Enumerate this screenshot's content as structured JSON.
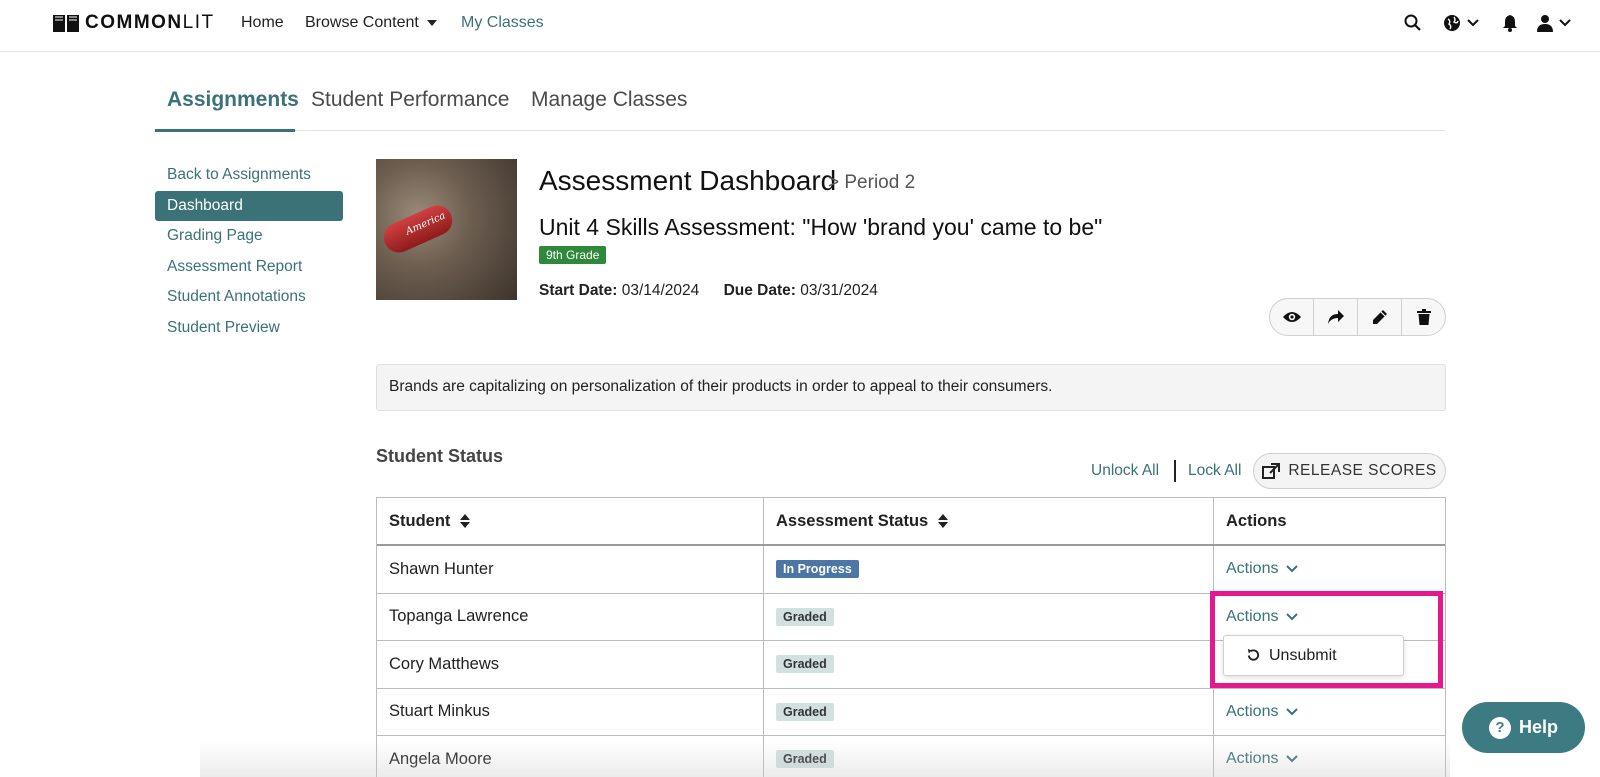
{
  "topnav": {
    "logo_bold": "COMMON",
    "logo_light": "LIT",
    "home": "Home",
    "browse": "Browse Content",
    "my_classes": "My Classes"
  },
  "tabs": [
    "Assignments",
    "Student Performance",
    "Manage Classes"
  ],
  "sidebar": {
    "items": [
      {
        "label": "Back to Assignments"
      },
      {
        "label": "Dashboard"
      },
      {
        "label": "Grading Page"
      },
      {
        "label": "Assessment Report"
      },
      {
        "label": "Student Annotations"
      },
      {
        "label": "Student Preview"
      }
    ]
  },
  "header": {
    "title": "Assessment Dashboard",
    "period": "> Period 2",
    "unit_title": "Unit 4 Skills Assessment: \"How 'brand you' came to be\"",
    "grade": "9th Grade",
    "start_label": "Start Date:",
    "start_value": "03/14/2024",
    "due_label": "Due Date:",
    "due_value": "03/31/2024",
    "thumb_text": "America"
  },
  "summary": "Brands are capitalizing on personalization of their products in order to appeal to their consumers.",
  "status": {
    "title": "Student Status",
    "unlock_all": "Unlock All",
    "lock_all": "Lock All",
    "release_scores": "RELEASE SCORES"
  },
  "table": {
    "headers": {
      "student": "Student",
      "status": "Assessment Status",
      "actions": "Actions"
    },
    "rows": [
      {
        "student": "Shawn Hunter",
        "status": "In Progress",
        "actions": "Actions"
      },
      {
        "student": "Topanga Lawrence",
        "status": "Graded",
        "actions": "Actions"
      },
      {
        "student": "Cory Matthews",
        "status": "Graded",
        "actions": ""
      },
      {
        "student": "Stuart Minkus",
        "status": "Graded",
        "actions": "Actions"
      },
      {
        "student": "Angela Moore",
        "status": "Graded",
        "actions": "Actions"
      }
    ]
  },
  "dropdown": {
    "unsubmit": "Unsubmit"
  },
  "help": "Help",
  "colors": {
    "accent": "#3a7277",
    "highlight": "#e6178f",
    "grade_badge": "#2e8a3a",
    "in_progress": "#4c76a6"
  }
}
